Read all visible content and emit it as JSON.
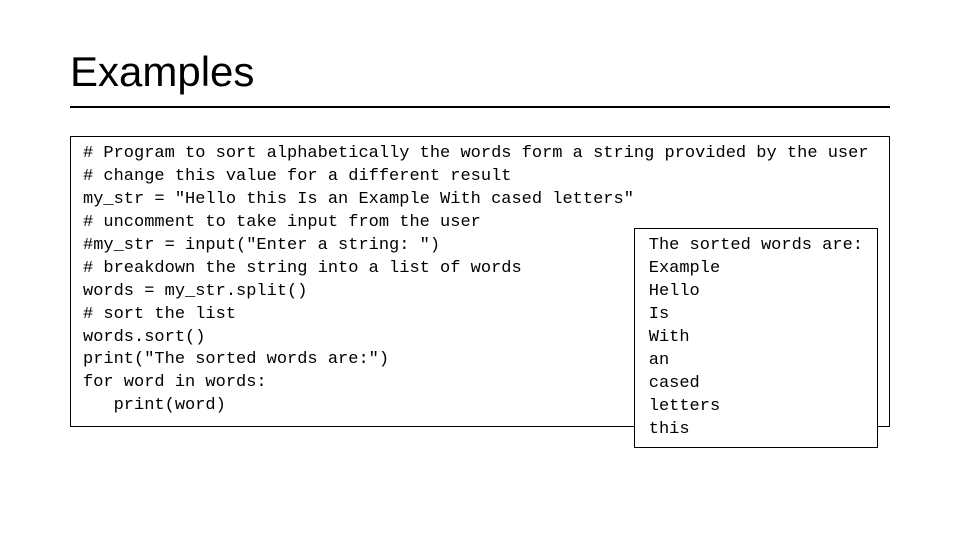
{
  "title": "Examples",
  "code": "# Program to sort alphabetically the words form a string provided by the user\n# change this value for a different result\nmy_str = \"Hello this Is an Example With cased letters\"\n# uncomment to take input from the user\n#my_str = input(\"Enter a string: \")\n# breakdown the string into a list of words\nwords = my_str.split()\n# sort the list\nwords.sort()\nprint(\"The sorted words are:\")\nfor word in words:\n   print(word)",
  "output": "The sorted words are:\nExample\nHello\nIs\nWith\nan\ncased\nletters\nthis"
}
